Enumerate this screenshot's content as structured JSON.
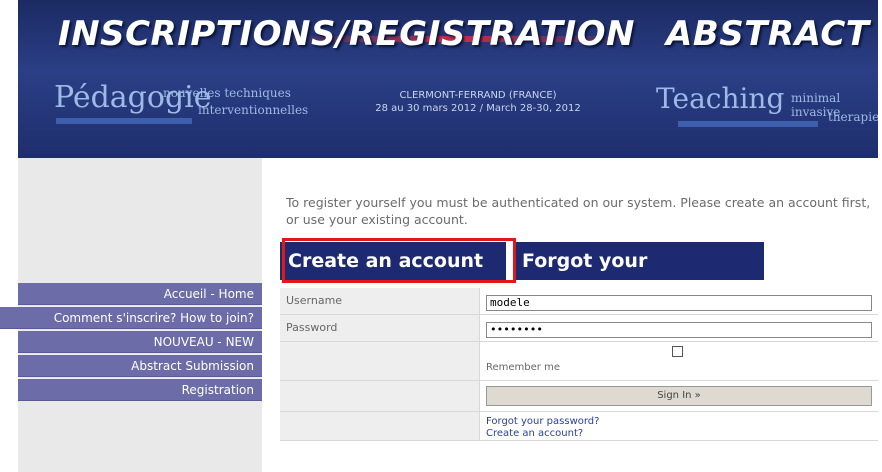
{
  "header": {
    "title_left": "INSCRIPTIONS/REGISTRATION",
    "title_right": "ABSTRACT",
    "pedagogie": "Pédagogie",
    "pedagogie_sub1": "nouvelles techniques",
    "pedagogie_sub2": "interventionnelles",
    "teaching": "Teaching",
    "teaching_sub1": "minimal invasive",
    "teaching_sub2": "therapies",
    "location": "CLERMONT-FERRAND (FRANCE)",
    "dates": "28 au 30 mars 2012 / March 28-30, 2012"
  },
  "sidebar": {
    "items": [
      {
        "label": "Accueil - Home"
      },
      {
        "label": "Comment s'inscrire? How to join?"
      },
      {
        "label": "NOUVEAU - NEW"
      },
      {
        "label": "Abstract Submission"
      },
      {
        "label": "Registration"
      }
    ]
  },
  "main": {
    "intro": "To register yourself you must be authenticated on our system. Please create an account first, or use your existing account.",
    "tabs": {
      "create": "Create an account",
      "forgot": "Forgot your password?"
    },
    "form": {
      "username_label": "Username",
      "username_value": "modele",
      "password_label": "Password",
      "password_value": "••••••••",
      "remember_label": "Remember me",
      "signin_label": "Sign In »",
      "link_forgot": "Forgot your password?",
      "link_create": "Create an account?"
    }
  },
  "colors": {
    "banner": "#1e2e6c",
    "nav": "#6c6ca8",
    "tab": "#1d2a72",
    "highlight": "#e01818"
  }
}
